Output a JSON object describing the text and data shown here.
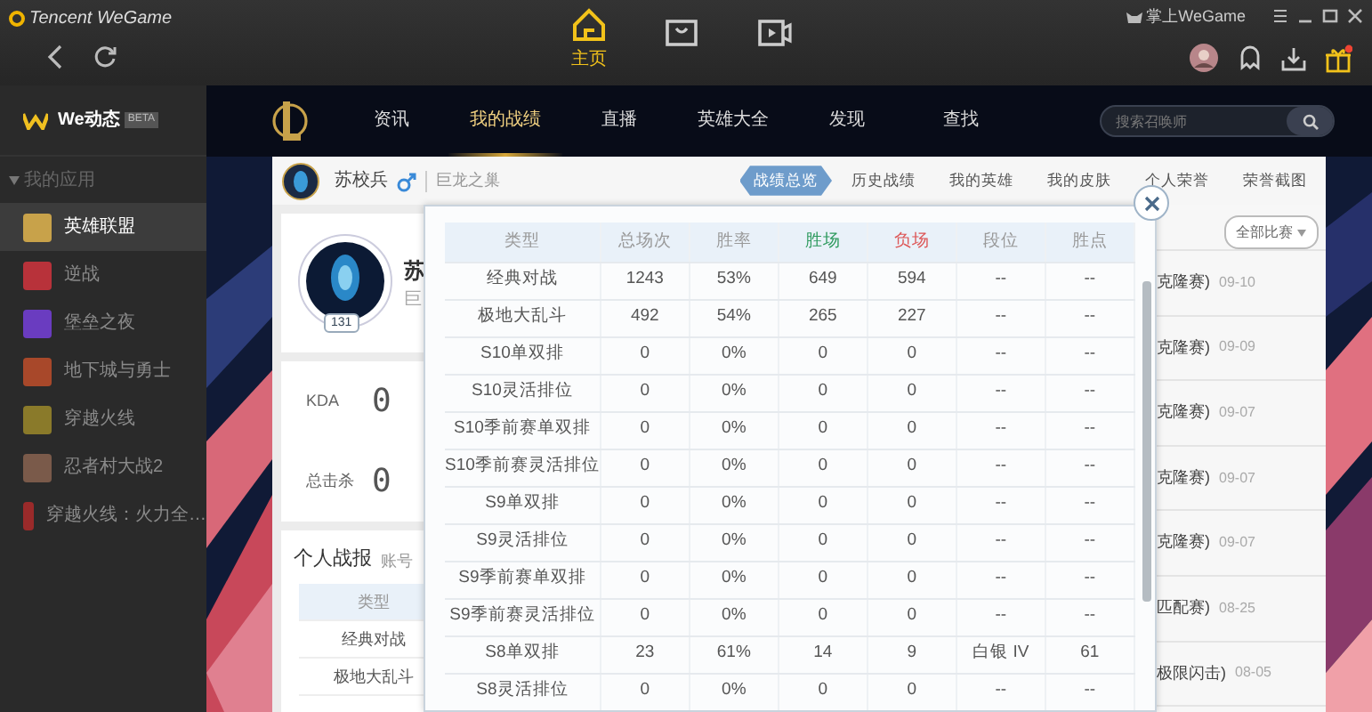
{
  "titlebar": {
    "brand": "Tencent WeGame",
    "mobile_link": "掌上WeGame",
    "gift_notification": true
  },
  "top_nav": [
    {
      "kind": "home",
      "label": "主页",
      "selected": true
    },
    {
      "kind": "store",
      "selected": false
    },
    {
      "kind": "video",
      "selected": false
    }
  ],
  "sidebar": {
    "feed": {
      "label": "We动态",
      "badge": "BETA"
    },
    "section": "我的应用",
    "items": [
      {
        "label": "英雄联盟",
        "selected": true,
        "color": "#c8a24a"
      },
      {
        "label": "逆战",
        "selected": false,
        "color": "#b8323a"
      },
      {
        "label": "堡垒之夜",
        "selected": false,
        "color": "#6a3cc0"
      },
      {
        "label": "地下城与勇士",
        "selected": false,
        "color": "#a8482a"
      },
      {
        "label": "穿越火线",
        "selected": false,
        "color": "#8a7a2a"
      },
      {
        "label": "忍者村大战2",
        "selected": false,
        "color": "#7a5a4a"
      },
      {
        "label": "穿越火线：火力全…",
        "selected": false,
        "color": "#9a2a2a"
      }
    ]
  },
  "game_nav": {
    "tabs": [
      {
        "label": "资讯",
        "selected": false
      },
      {
        "label": "我的战绩",
        "selected": true
      },
      {
        "label": "直播",
        "selected": false
      },
      {
        "label": "英雄大全",
        "selected": false
      },
      {
        "label": "发现",
        "selected": false
      },
      {
        "label": "查找",
        "selected": false
      }
    ],
    "search_placeholder": "搜索召唤师"
  },
  "profile_bar": {
    "name": "苏校兵",
    "server": "巨龙之巢",
    "tabs": [
      {
        "label": "战绩总览",
        "selected": true
      },
      {
        "label": "历史战绩",
        "selected": false
      },
      {
        "label": "我的英雄",
        "selected": false
      },
      {
        "label": "我的皮肤",
        "selected": false
      },
      {
        "label": "个人荣誉",
        "selected": false
      },
      {
        "label": "荣誉截图",
        "selected": false
      }
    ]
  },
  "profile_card": {
    "level": "131",
    "name": "苏",
    "server": "巨"
  },
  "stats": [
    {
      "label": "KDA",
      "value": "0"
    },
    {
      "label": "总击杀",
      "value": "0"
    }
  ],
  "report": {
    "title": "个人战报",
    "tab": "账号",
    "table": {
      "columns": [
        "类型"
      ],
      "rows": [
        "经典对战",
        "极地大乱斗"
      ]
    }
  },
  "popup": {
    "columns": [
      {
        "label": "类型",
        "kind": "normal"
      },
      {
        "label": "总场次",
        "kind": "normal"
      },
      {
        "label": "胜率",
        "kind": "normal"
      },
      {
        "label": "胜场",
        "kind": "win"
      },
      {
        "label": "负场",
        "kind": "loss"
      },
      {
        "label": "段位",
        "kind": "normal"
      },
      {
        "label": "胜点",
        "kind": "normal"
      }
    ],
    "rows": [
      [
        "经典对战",
        "1243",
        "53%",
        "649",
        "594",
        "--",
        "--"
      ],
      [
        "极地大乱斗",
        "492",
        "54%",
        "265",
        "227",
        "--",
        "--"
      ],
      [
        "S10单双排",
        "0",
        "0%",
        "0",
        "0",
        "--",
        "--"
      ],
      [
        "S10灵活排位",
        "0",
        "0%",
        "0",
        "0",
        "--",
        "--"
      ],
      [
        "S10季前赛单双排",
        "0",
        "0%",
        "0",
        "0",
        "--",
        "--"
      ],
      [
        "S10季前赛灵活排位",
        "0",
        "0%",
        "0",
        "0",
        "--",
        "--"
      ],
      [
        "S9单双排",
        "0",
        "0%",
        "0",
        "0",
        "--",
        "--"
      ],
      [
        "S9灵活排位",
        "0",
        "0%",
        "0",
        "0",
        "--",
        "--"
      ],
      [
        "S9季前赛单双排",
        "0",
        "0%",
        "0",
        "0",
        "--",
        "--"
      ],
      [
        "S9季前赛灵活排位",
        "0",
        "0%",
        "0",
        "0",
        "--",
        "--"
      ],
      [
        "S8单双排",
        "23",
        "61%",
        "14",
        "9",
        "白银 IV",
        "61"
      ],
      [
        "S8灵活排位",
        "0",
        "0%",
        "0",
        "0",
        "--",
        "--"
      ]
    ]
  },
  "matches": {
    "filter": "全部比赛",
    "items": [
      {
        "mode": "克隆赛)",
        "date": "09-10"
      },
      {
        "mode": "克隆赛)",
        "date": "09-09"
      },
      {
        "mode": "克隆赛)",
        "date": "09-07"
      },
      {
        "mode": "克隆赛)",
        "date": "09-07"
      },
      {
        "mode": "克隆赛)",
        "date": "09-07"
      },
      {
        "mode": "匹配赛)",
        "date": "08-25"
      },
      {
        "mode": "极限闪击)",
        "date": "08-05"
      }
    ]
  }
}
